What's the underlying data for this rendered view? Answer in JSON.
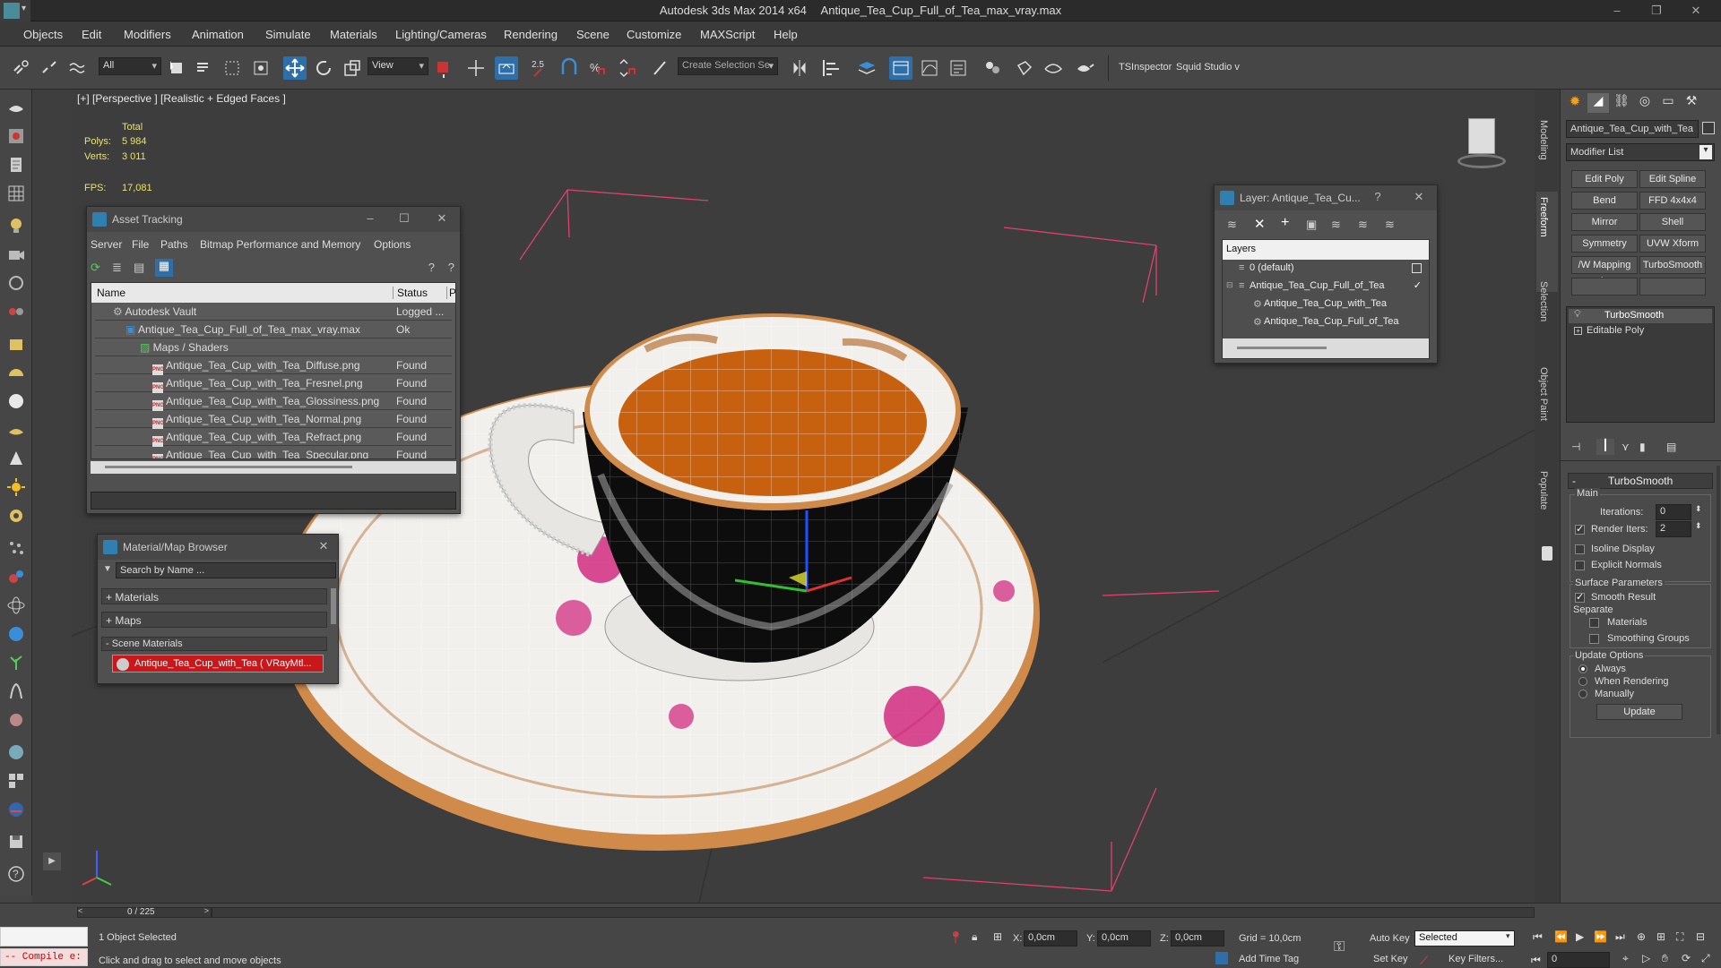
{
  "titlebar": {
    "app": "Autodesk 3ds Max  2014 x64",
    "file": "Antique_Tea_Cup_Full_of_Tea_max_vray.max"
  },
  "menu": [
    "Objects",
    "Edit",
    "Modifiers",
    "Animation",
    "Simulate",
    "Materials",
    "Lighting/Cameras",
    "Rendering",
    "Scene",
    "Customize",
    "MAXScript",
    "Help"
  ],
  "toolbar": {
    "filter": "All",
    "refcoord": "View",
    "snap_label": "2.5",
    "selection_set": "Create Selection Se",
    "tsinspector": "TSInspector",
    "squid": "Squid Studio v"
  },
  "viewport": {
    "label": "[+] [Perspective ] [Realistic + Edged Faces ]",
    "stats_total": "Total",
    "polys_label": "Polys:",
    "polys_value": "5 984",
    "verts_label": "Verts:",
    "verts_value": "3 011",
    "fps_label": "FPS:",
    "fps_value": "17,081"
  },
  "asset_tracking": {
    "title": "Asset Tracking",
    "menu": [
      "Server",
      "File",
      "Paths",
      "Bitmap Performance and Memory",
      "Options"
    ],
    "col_name": "Name",
    "col_status": "Status",
    "col_p": "P",
    "rows": [
      {
        "name": "Autodesk Vault",
        "status": "Logged ...",
        "indent": 0
      },
      {
        "name": "Antique_Tea_Cup_Full_of_Tea_max_vray.max",
        "status": "Ok",
        "indent": 1
      },
      {
        "name": "Maps / Shaders",
        "status": "",
        "indent": 2
      },
      {
        "name": "Antique_Tea_Cup_with_Tea_Diffuse.png",
        "status": "Found",
        "indent": 3
      },
      {
        "name": "Antique_Tea_Cup_with_Tea_Fresnel.png",
        "status": "Found",
        "indent": 3
      },
      {
        "name": "Antique_Tea_Cup_with_Tea_Glossiness.png",
        "status": "Found",
        "indent": 3
      },
      {
        "name": "Antique_Tea_Cup_with_Tea_Normal.png",
        "status": "Found",
        "indent": 3
      },
      {
        "name": "Antique_Tea_Cup_with_Tea_Refract.png",
        "status": "Found",
        "indent": 3
      },
      {
        "name": "Antique_Tea_Cup_with_Tea_Specular.png",
        "status": "Found",
        "indent": 3
      }
    ]
  },
  "material_browser": {
    "title": "Material/Map Browser",
    "search_placeholder": "Search by Name ...",
    "groups": [
      "+ Materials",
      "+ Maps",
      "- Scene Materials"
    ],
    "scene_material": "Antique_Tea_Cup_with_Tea  ( VRayMtl..."
  },
  "layer_window": {
    "title": "Layer: Antique_Tea_Cu...",
    "help": "?",
    "header": "Layers",
    "items": [
      "0 (default)",
      "Antique_Tea_Cup_Full_of_Tea",
      "Antique_Tea_Cup_with_Tea",
      "Antique_Tea_Cup_Full_of_Tea"
    ]
  },
  "ribbon_tabs": [
    "Modeling",
    "Freeform",
    "Selection",
    "Object Paint",
    "Populate"
  ],
  "command_panel": {
    "object_name": "Antique_Tea_Cup_with_Tea",
    "modifier_list": "Modifier List",
    "buttons": [
      "Edit Poly",
      "Edit Spline",
      "Bend",
      "FFD 4x4x4",
      "Mirror",
      "Shell",
      "Symmetry",
      "UVW Xform",
      "/W Mapping Ac",
      "TurboSmooth"
    ],
    "stack": [
      "TurboSmooth",
      "Editable Poly"
    ],
    "turbosmooth": {
      "title": "TurboSmooth",
      "main": "Main",
      "iterations_label": "Iterations:",
      "iterations_value": "0",
      "render_iters_label": "Render Iters:",
      "render_iters_value": "2",
      "isoline": "Isoline Display",
      "explicit": "Explicit Normals",
      "surface": "Surface Parameters",
      "smooth_result": "Smooth Result",
      "separate": "Separate",
      "materials": "Materials",
      "smoothing_groups": "Smoothing Groups",
      "update_options": "Update Options",
      "always": "Always",
      "when_rendering": "When Rendering",
      "manually": "Manually",
      "update": "Update"
    }
  },
  "status": {
    "time_slider": "0 / 225",
    "maxscript": "-- Compile e:",
    "selected": "1 Object Selected",
    "prompt": "Click and drag to select and move objects",
    "x_label": "X:",
    "x_value": "0,0cm",
    "y_label": "Y:",
    "y_value": "0,0cm",
    "z_label": "Z:",
    "z_value": "0,0cm",
    "grid": "Grid = 10,0cm",
    "add_time_tag": "Add Time Tag",
    "auto_key": "Auto Key",
    "set_key": "Set Key",
    "key_mode": "Selected",
    "key_filters": "Key Filters...",
    "frame": "0"
  },
  "colors": {
    "accent": "#2f6fa8",
    "tea": "#c8610f",
    "stats": "#e6e36e",
    "material_swatch": "#c8181b"
  }
}
